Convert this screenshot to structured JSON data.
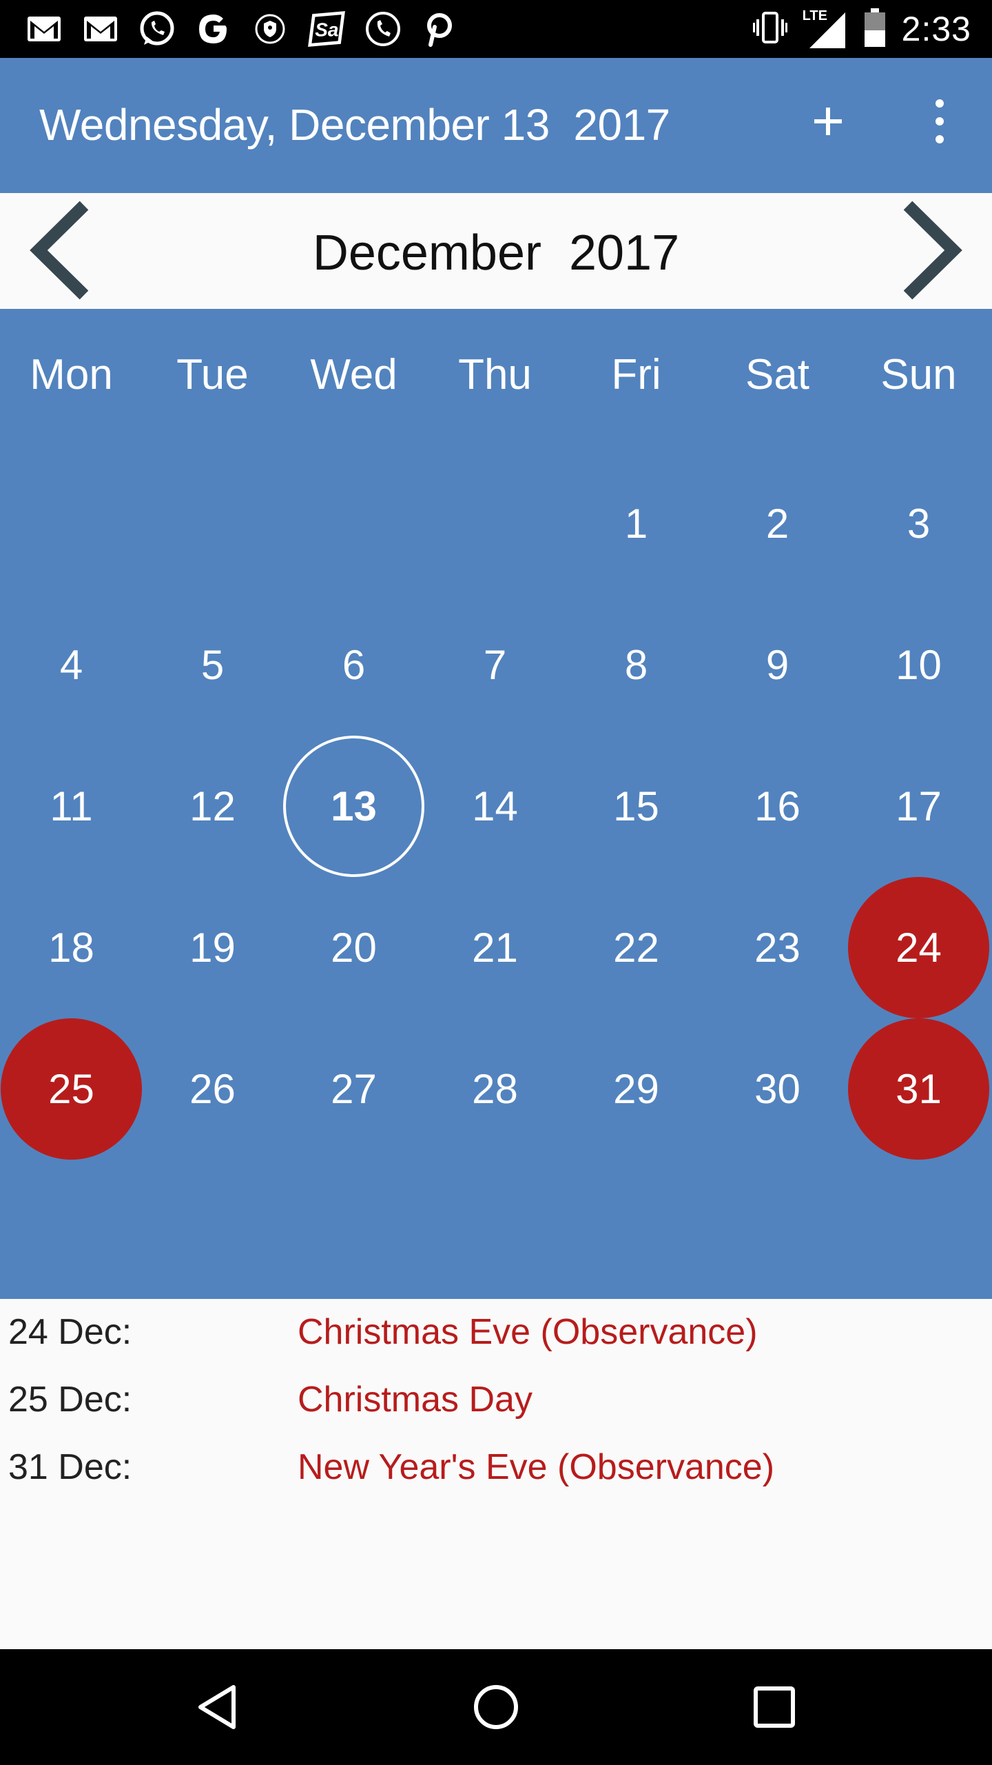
{
  "status_bar": {
    "time": "2:33",
    "network": "LTE",
    "left_icons": [
      "gmail-icon",
      "gmail-icon",
      "whatsapp-icon",
      "google-icon",
      "shield-icon",
      "sa-app-icon",
      "phone-icon",
      "pinterest-icon"
    ],
    "right_icons": [
      "vibrate-icon",
      "signal-icon",
      "battery-icon"
    ]
  },
  "app_bar": {
    "title": "Wednesday, December 13  2017",
    "add_icon": "plus-icon",
    "more_icon": "more-vert-icon"
  },
  "month_header": {
    "label": "December  2017",
    "prev_icon": "chevron-left-icon",
    "next_icon": "chevron-right-icon"
  },
  "calendar": {
    "weekdays": [
      "Mon",
      "Tue",
      "Wed",
      "Thu",
      "Fri",
      "Sat",
      "Sun"
    ],
    "first_day_column": 4,
    "days_in_month": 31,
    "today": 13,
    "holidays": [
      24,
      25,
      31
    ]
  },
  "holiday_list": [
    {
      "date": "24 Dec:",
      "name": "Christmas Eve (Observance)"
    },
    {
      "date": "25 Dec:",
      "name": "Christmas Day"
    },
    {
      "date": "31 Dec:",
      "name": "New Year's Eve (Observance)"
    }
  ],
  "nav_bar": {
    "icons": [
      "back-icon",
      "home-icon",
      "recents-icon"
    ]
  },
  "colors": {
    "primary": "#5283be",
    "holiday": "#b71c1c",
    "status_bar": "#000000",
    "background": "#fafafa"
  }
}
